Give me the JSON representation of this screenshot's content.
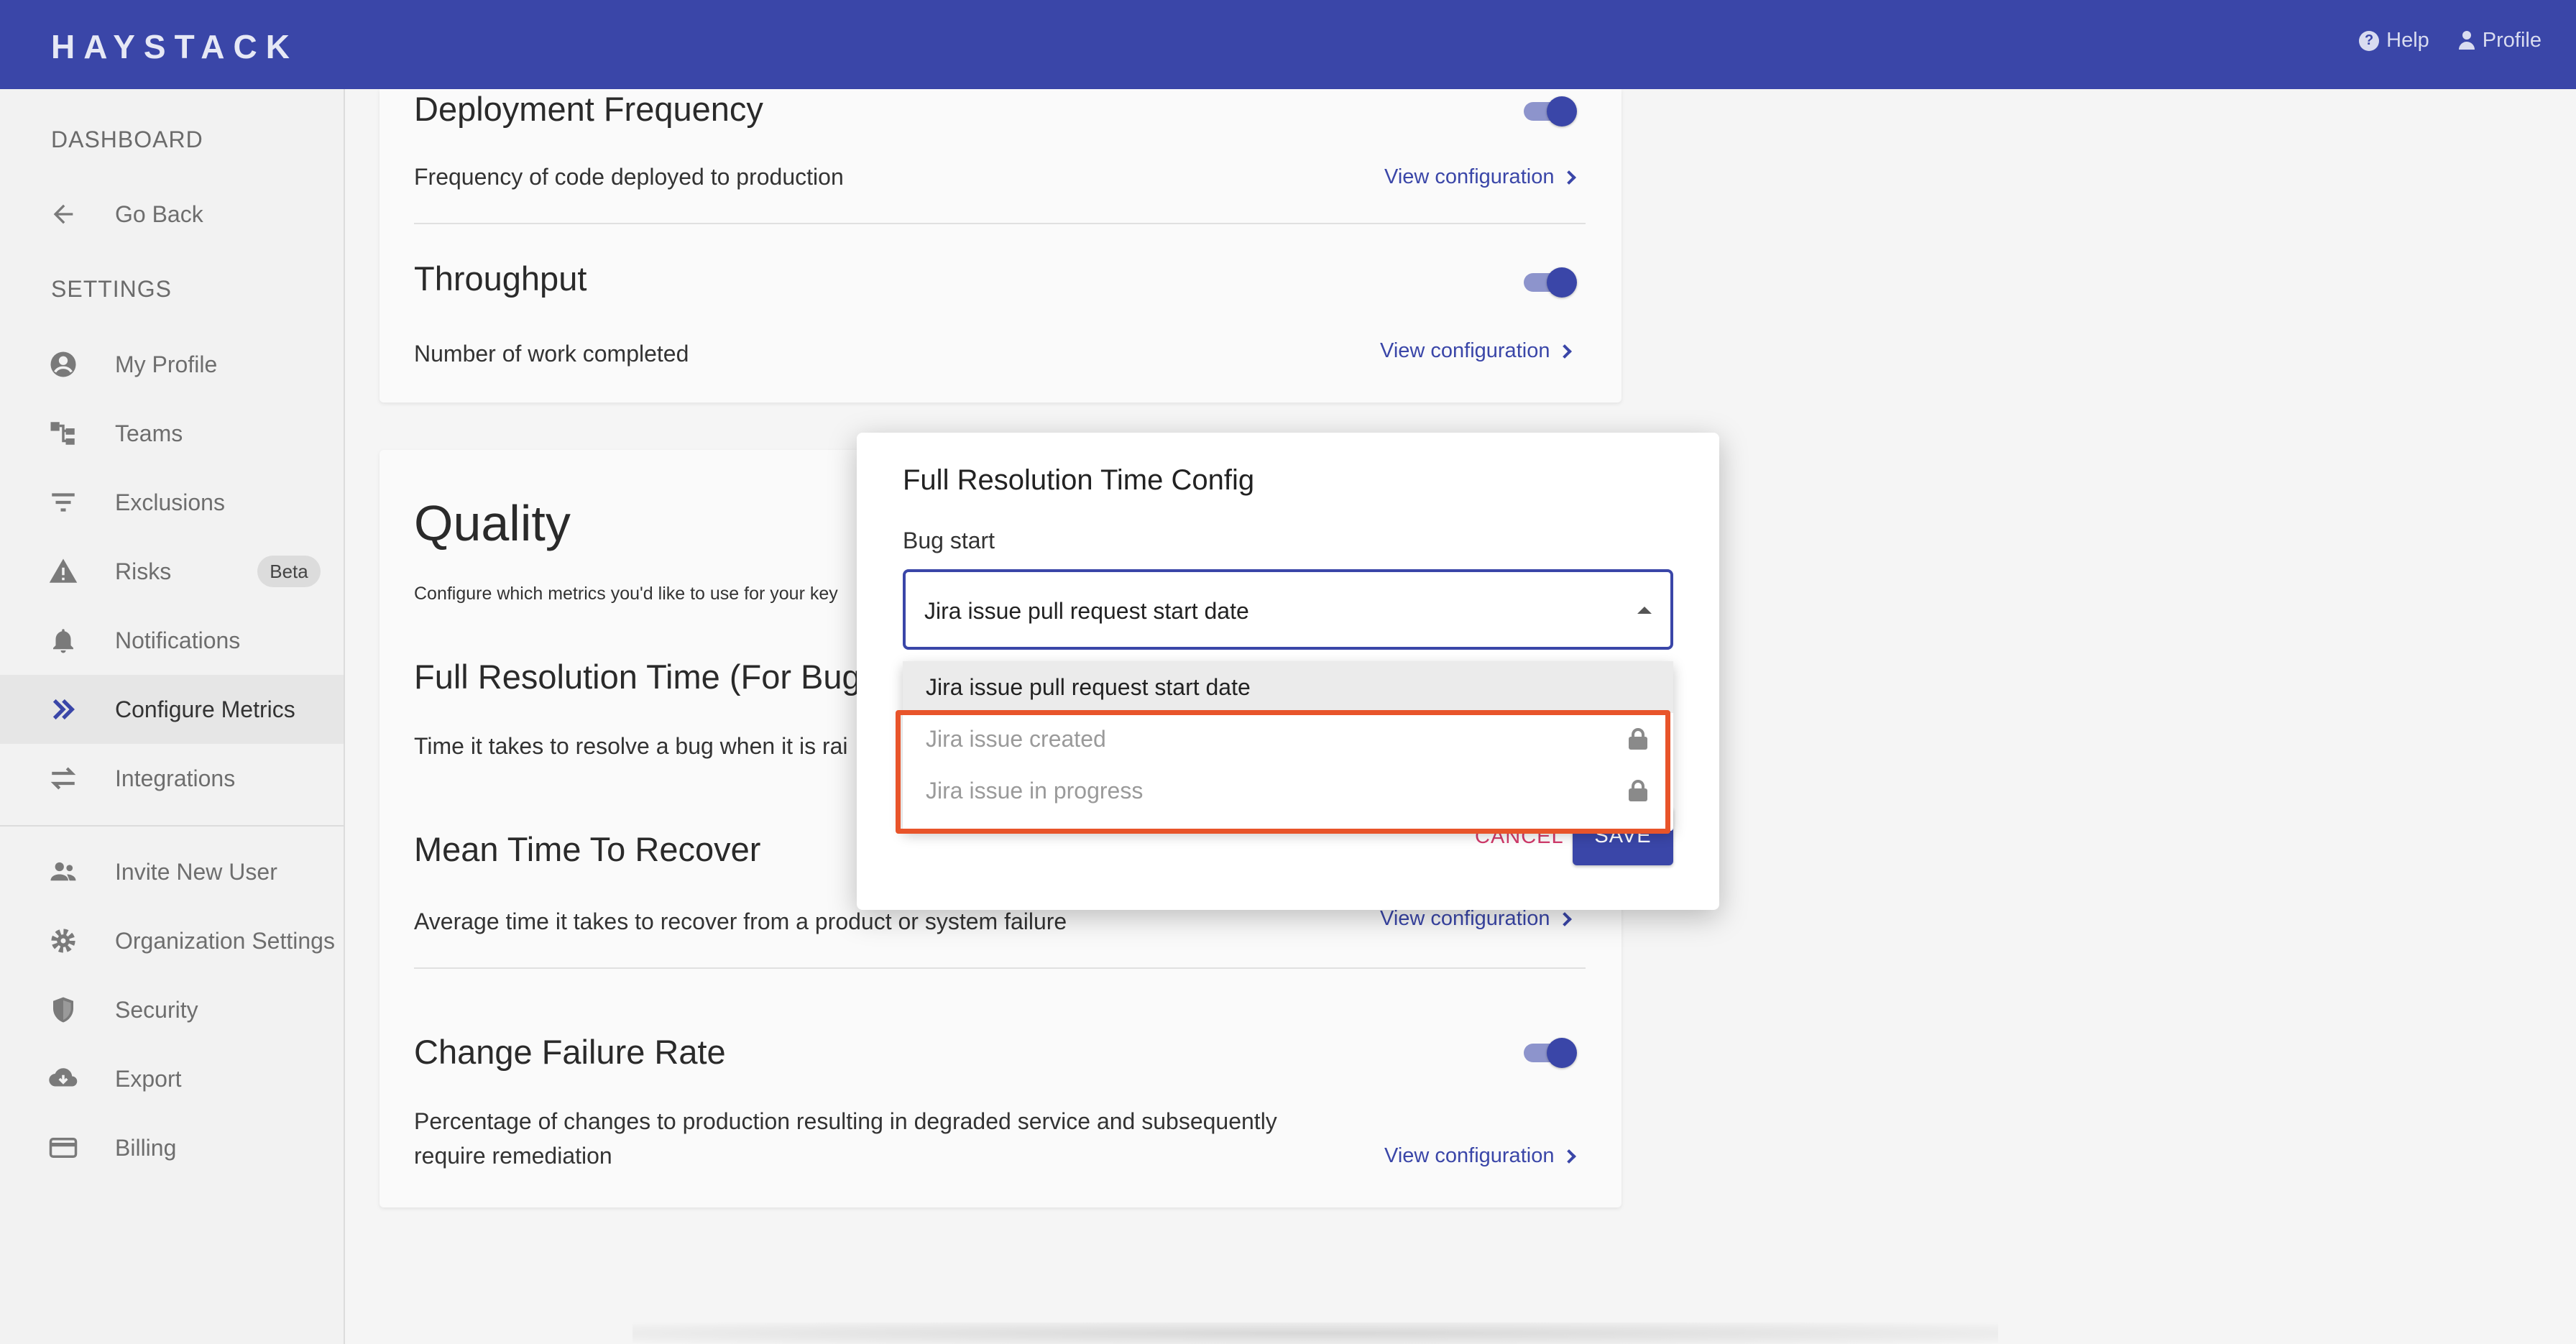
{
  "topbar": {
    "logo": "HAYSTACK",
    "help_label": "Help",
    "profile_label": "Profile"
  },
  "sidebar": {
    "dashboard_heading": "DASHBOARD",
    "go_back": "Go Back",
    "settings_heading": "SETTINGS",
    "items": [
      {
        "label": "My Profile",
        "icon": "account-circle-icon"
      },
      {
        "label": "Teams",
        "icon": "teams-icon"
      },
      {
        "label": "Exclusions",
        "icon": "filter-icon"
      },
      {
        "label": "Risks",
        "icon": "warning-icon",
        "badge": "Beta"
      },
      {
        "label": "Notifications",
        "icon": "bell-icon"
      },
      {
        "label": "Configure Metrics",
        "icon": "double-chevron-icon",
        "active": true
      },
      {
        "label": "Integrations",
        "icon": "swap-icon"
      }
    ],
    "admin_items": [
      {
        "label": "Invite New User",
        "icon": "people-icon"
      },
      {
        "label": "Organization Settings",
        "icon": "gear-icon"
      },
      {
        "label": "Security",
        "icon": "shield-icon"
      },
      {
        "label": "Export",
        "icon": "cloud-download-icon"
      },
      {
        "label": "Billing",
        "icon": "credit-card-icon"
      }
    ]
  },
  "velocity_card": {
    "deployment_frequency": {
      "title": "Deployment Frequency",
      "desc": "Frequency of code deployed to production",
      "link": "View configuration"
    },
    "throughput": {
      "title": "Throughput",
      "desc": "Number of work completed",
      "link": "View configuration"
    }
  },
  "quality_card": {
    "heading": "Quality",
    "subheading": "Configure which metrics you'd like to use for your key",
    "full_resolution": {
      "title": "Full Resolution Time (For Bug",
      "desc": "Time it takes to resolve a bug when it is rai"
    },
    "mttr": {
      "title": "Mean Time To Recover",
      "desc": "Average time it takes to recover from a product or system failure",
      "link": "View configuration"
    },
    "change_failure_rate": {
      "title": "Change Failure Rate",
      "desc_line1": "Percentage of changes to production resulting in degraded service and subsequently",
      "desc_line2": "require remediation",
      "link": "View configuration"
    }
  },
  "modal": {
    "title": "Full Resolution Time Config",
    "field_label": "Bug start",
    "selected_value": "Jira issue pull request start date",
    "options": [
      {
        "label": "Jira issue pull request start date",
        "selected": true,
        "locked": false
      },
      {
        "label": "Jira issue created",
        "selected": false,
        "locked": true
      },
      {
        "label": "Jira issue in progress",
        "selected": false,
        "locked": true
      }
    ],
    "cancel_label": "CANCEL",
    "save_label": "SAVE"
  },
  "colors": {
    "primary": "#3a46a8",
    "cancel": "#d23a6b",
    "highlight": "#e8542a"
  }
}
